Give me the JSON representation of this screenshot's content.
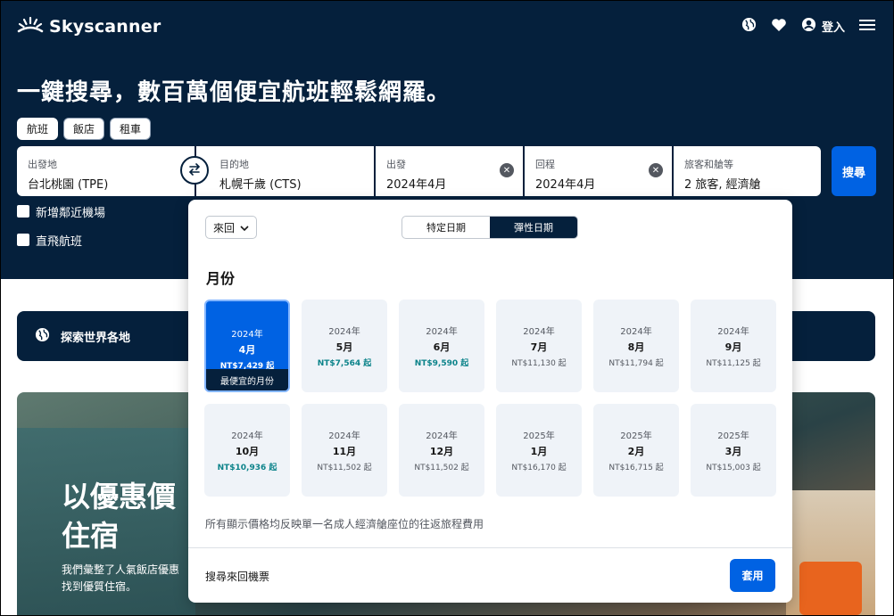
{
  "brand": {
    "name": "Skyscanner"
  },
  "header": {
    "login_label": "登入"
  },
  "headline": "一鍵搜尋，數百萬個便宜航班輕鬆網羅。",
  "tabs": [
    {
      "label": "航班"
    },
    {
      "label": "飯店"
    },
    {
      "label": "租車"
    }
  ],
  "search": {
    "origin": {
      "label": "出發地",
      "value": "台北桃園 (TPE)"
    },
    "destination": {
      "label": "目的地",
      "value": "札幌千歲 (CTS)"
    },
    "depart": {
      "label": "出發",
      "value": "2024年4月"
    },
    "return": {
      "label": "回程",
      "value": "2024年4月"
    },
    "travellers": {
      "label": "旅客和艙等",
      "value": "2 旅客, 經濟艙"
    },
    "search_button": "搜尋"
  },
  "options": {
    "nearby_airports": "新增鄰近機場",
    "direct_flights": "直飛航班"
  },
  "explore_label": "探索世界各地",
  "promo": {
    "title_line1": "以優惠價",
    "title_line2": "住宿",
    "sub_line1": "我們彙整了人氣飯店優惠",
    "sub_line2": "找到優質住宿。"
  },
  "picker": {
    "trip_type": "來回",
    "mode_specific": "特定日期",
    "mode_flexible": "彈性日期",
    "months_title": "月份",
    "cheapest_label": "最便宜的月份",
    "months": [
      {
        "year": "2024年",
        "month": "4月",
        "price": "NT$7,429 起",
        "cheap": true,
        "selected": true
      },
      {
        "year": "2024年",
        "month": "5月",
        "price": "NT$7,564 起",
        "cheap": true
      },
      {
        "year": "2024年",
        "month": "6月",
        "price": "NT$9,590 起",
        "cheap": true
      },
      {
        "year": "2024年",
        "month": "7月",
        "price": "NT$11,130 起"
      },
      {
        "year": "2024年",
        "month": "8月",
        "price": "NT$11,794 起"
      },
      {
        "year": "2024年",
        "month": "9月",
        "price": "NT$11,125 起"
      },
      {
        "year": "2024年",
        "month": "10月",
        "price": "NT$10,936 起",
        "cheap": true
      },
      {
        "year": "2024年",
        "month": "11月",
        "price": "NT$11,502 起"
      },
      {
        "year": "2024年",
        "month": "12月",
        "price": "NT$11,502 起"
      },
      {
        "year": "2025年",
        "month": "1月",
        "price": "NT$16,170 起"
      },
      {
        "year": "2025年",
        "month": "2月",
        "price": "NT$16,715 起"
      },
      {
        "year": "2025年",
        "month": "3月",
        "price": "NT$15,003 起"
      }
    ],
    "note": "所有顯示價格均反映單一名成人經濟艙座位的往返旅程費用",
    "footer_label": "搜尋來回機票",
    "apply_label": "套用"
  },
  "colors": {
    "navy": "#05203c",
    "primary": "#0062e3",
    "cheap_price": "#0c838a"
  },
  "icons": [
    "skyscanner-logo-icon",
    "globe-icon",
    "heart-icon",
    "user-icon",
    "menu-icon",
    "swap-icon",
    "clear-icon",
    "chevron-down-icon"
  ]
}
